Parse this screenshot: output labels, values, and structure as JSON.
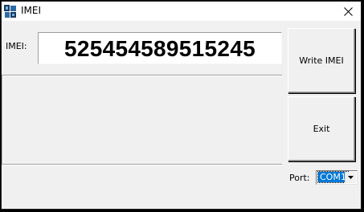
{
  "window": {
    "title": "IMEI",
    "app_icon": "app-icon",
    "close_icon": "close-icon"
  },
  "imei": {
    "label": "IMEI:",
    "value": "525454589515245"
  },
  "buttons": {
    "write_label": "Write IMEI",
    "exit_label": "Exit"
  },
  "port": {
    "label": "Port:",
    "selected": "COM1",
    "dropdown_icon": "chevron-down-icon"
  },
  "colors": {
    "face": "#f0f0f0",
    "selection": "#0078d7",
    "frame": "#000000"
  }
}
